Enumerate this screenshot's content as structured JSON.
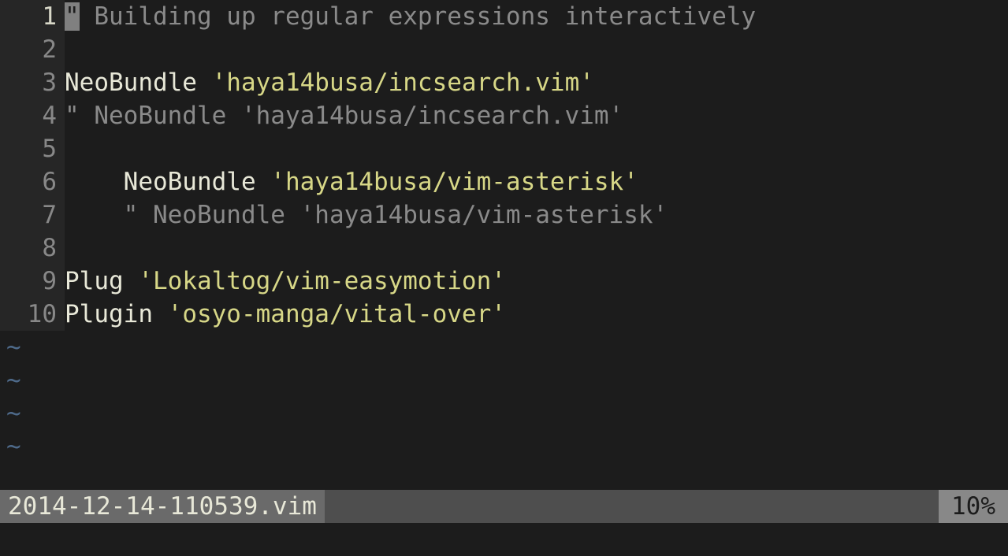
{
  "lines": [
    {
      "num": "1",
      "segments": [
        {
          "cls": "cursor",
          "text": "\""
        },
        {
          "cls": "comment",
          "text": " Building up regular expressions interactively"
        }
      ]
    },
    {
      "num": "2",
      "segments": []
    },
    {
      "num": "3",
      "segments": [
        {
          "cls": "keyword",
          "text": "NeoBundle "
        },
        {
          "cls": "string",
          "text": "'haya14busa/incsearch.vim'"
        }
      ]
    },
    {
      "num": "4",
      "segments": [
        {
          "cls": "comment",
          "text": "\" NeoBundle 'haya14busa/incsearch.vim'"
        }
      ]
    },
    {
      "num": "5",
      "segments": []
    },
    {
      "num": "6",
      "segments": [
        {
          "cls": "keyword",
          "text": "    NeoBundle "
        },
        {
          "cls": "string",
          "text": "'haya14busa/vim-asterisk'"
        }
      ]
    },
    {
      "num": "7",
      "segments": [
        {
          "cls": "comment",
          "text": "    \" NeoBundle 'haya14busa/vim-asterisk'"
        }
      ]
    },
    {
      "num": "8",
      "segments": []
    },
    {
      "num": "9",
      "segments": [
        {
          "cls": "keyword",
          "text": "Plug "
        },
        {
          "cls": "string",
          "text": "'Lokaltog/vim-easymotion'"
        }
      ]
    },
    {
      "num": "10",
      "segments": [
        {
          "cls": "keyword",
          "text": "Plugin "
        },
        {
          "cls": "string",
          "text": "'osyo-manga/vital-over'"
        }
      ]
    }
  ],
  "tilde_rows": 4,
  "tilde_char": "~",
  "status": {
    "filename": "2014-12-14-110539.vim",
    "percent": "10%"
  },
  "cursor_line_index": 0
}
